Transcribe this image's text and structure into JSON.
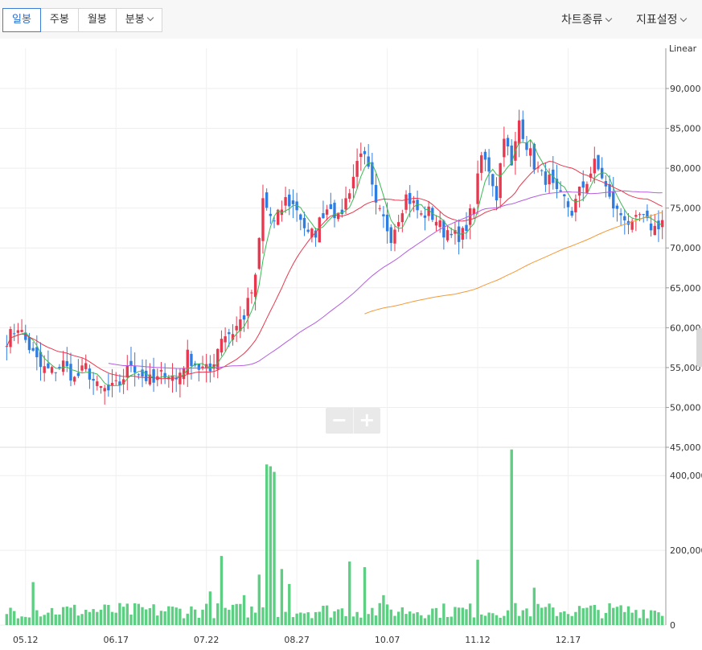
{
  "toolbar": {
    "tabs": [
      {
        "label": "일봉",
        "active": true
      },
      {
        "label": "주봉",
        "active": false
      },
      {
        "label": "월봉",
        "active": false
      },
      {
        "label": "분봉",
        "active": false
      }
    ],
    "chart_type_label": "차트종류",
    "indicator_label": "지표설정"
  },
  "zoom": {
    "minus": "−",
    "plus": "+"
  },
  "colors": {
    "up": "#e8384f",
    "down": "#2f7de1",
    "volume": "#5ccf82",
    "ma5": "#3cba54",
    "ma20": "#e8384f",
    "ma60": "#b45ee0",
    "ma120": "#f39a3a"
  },
  "chart_data": {
    "type": "candlestick",
    "scale_label": "Linear",
    "price_axis": {
      "min": 45000,
      "max": 90000,
      "ticks": [
        "90,000",
        "85,000",
        "80,000",
        "75,000",
        "70,000",
        "65,000",
        "60,000",
        "55,000",
        "50,000",
        "45,000"
      ],
      "tick_values": [
        90000,
        85000,
        80000,
        75000,
        70000,
        65000,
        60000,
        55000,
        50000,
        45000
      ]
    },
    "volume_axis": {
      "min": 0,
      "max": 450000,
      "ticks": [
        "400,000",
        "200,000",
        "0"
      ],
      "tick_values": [
        400000,
        200000,
        0
      ]
    },
    "x_ticks": [
      {
        "label": "05.12",
        "index": 5
      },
      {
        "label": "06.17",
        "index": 29
      },
      {
        "label": "07.22",
        "index": 53
      },
      {
        "label": "08.27",
        "index": 77
      },
      {
        "label": "10.07",
        "index": 101
      },
      {
        "label": "11.12",
        "index": 125
      },
      {
        "label": "12.17",
        "index": 149
      }
    ],
    "close_anchors": [
      [
        0,
        58500
      ],
      [
        3,
        60200
      ],
      [
        6,
        57500
      ],
      [
        9,
        55000
      ],
      [
        12,
        54500
      ],
      [
        15,
        55500
      ],
      [
        18,
        53500
      ],
      [
        21,
        55000
      ],
      [
        24,
        52500
      ],
      [
        27,
        52000
      ],
      [
        30,
        53000
      ],
      [
        33,
        55500
      ],
      [
        36,
        54000
      ],
      [
        39,
        53000
      ],
      [
        42,
        54500
      ],
      [
        45,
        53500
      ],
      [
        48,
        56500
      ],
      [
        51,
        55000
      ],
      [
        54,
        54500
      ],
      [
        57,
        59000
      ],
      [
        60,
        59500
      ],
      [
        63,
        61500
      ],
      [
        66,
        66000
      ],
      [
        68,
        76000
      ],
      [
        71,
        73000
      ],
      [
        74,
        76000
      ],
      [
        77,
        75000
      ],
      [
        80,
        71500
      ],
      [
        82,
        72000
      ],
      [
        84,
        74500
      ],
      [
        86,
        75500
      ],
      [
        88,
        73500
      ],
      [
        90,
        76000
      ],
      [
        92,
        79000
      ],
      [
        94,
        82500
      ],
      [
        96,
        79500
      ],
      [
        98,
        75000
      ],
      [
        100,
        73500
      ],
      [
        102,
        71500
      ],
      [
        104,
        74000
      ],
      [
        106,
        76500
      ],
      [
        108,
        75500
      ],
      [
        110,
        74000
      ],
      [
        112,
        74500
      ],
      [
        114,
        73500
      ],
      [
        116,
        72000
      ],
      [
        118,
        72500
      ],
      [
        120,
        70500
      ],
      [
        122,
        73000
      ],
      [
        124,
        75500
      ],
      [
        126,
        81500
      ],
      [
        128,
        80000
      ],
      [
        130,
        76500
      ],
      [
        132,
        84500
      ],
      [
        134,
        80000
      ],
      [
        136,
        86000
      ],
      [
        138,
        83000
      ],
      [
        140,
        80500
      ],
      [
        142,
        79000
      ],
      [
        144,
        78500
      ],
      [
        146,
        76500
      ],
      [
        148,
        76000
      ],
      [
        150,
        74500
      ],
      [
        152,
        77000
      ],
      [
        154,
        78500
      ],
      [
        156,
        80500
      ],
      [
        158,
        79000
      ],
      [
        160,
        76000
      ],
      [
        162,
        74500
      ],
      [
        164,
        74000
      ],
      [
        166,
        72500
      ],
      [
        168,
        74000
      ],
      [
        170,
        73000
      ],
      [
        172,
        72500
      ],
      [
        174,
        73500
      ]
    ],
    "ma120_start_index": 95,
    "volume_spikes": [
      [
        7,
        115000
      ],
      [
        54,
        90000
      ],
      [
        57,
        185000
      ],
      [
        63,
        80000
      ],
      [
        67,
        135000
      ],
      [
        69,
        430000
      ],
      [
        70,
        425000
      ],
      [
        71,
        410000
      ],
      [
        73,
        150000
      ],
      [
        75,
        110000
      ],
      [
        91,
        170000
      ],
      [
        95,
        155000
      ],
      [
        100,
        80000
      ],
      [
        125,
        175000
      ],
      [
        134,
        470000
      ],
      [
        140,
        100000
      ]
    ]
  }
}
